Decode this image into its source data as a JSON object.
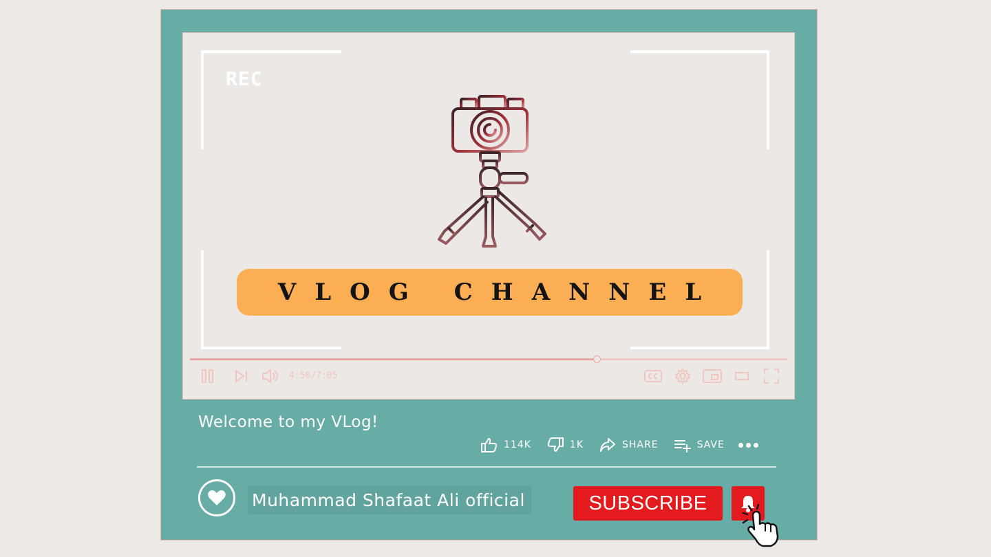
{
  "video": {
    "overlay_rec": "REC",
    "banner_text": "VLOG CHANNEL",
    "progress_fraction": 0.682,
    "time_display": "4:50/7:05",
    "title": "Welcome to my VLog!"
  },
  "icons": {
    "camera": "camera-on-tripod-icon",
    "pause": "pause-icon",
    "next": "next-icon",
    "volume": "volume-icon",
    "captions": "cc-icon",
    "settings": "gear-icon",
    "miniplayer": "miniplayer-icon",
    "theater": "theater-icon",
    "fullscreen": "fullscreen-icon",
    "like": "thumbs-up-icon",
    "dislike": "thumbs-down-icon",
    "share": "share-icon",
    "save": "playlist-add-icon",
    "more": "more-dots-icon",
    "avatar": "heart-icon",
    "bell": "bell-icon",
    "cursor": "hand-pointer-icon"
  },
  "actions": {
    "likes": "114K",
    "dislikes": "1K",
    "share_label": "SHARE",
    "save_label": "SAVE"
  },
  "channel": {
    "name": "Muhammad Shafaat Ali official",
    "subscribe_label": "SUBSCRIBE"
  },
  "colors": {
    "frame": "#67aca5",
    "screen": "#ece8e5",
    "banner": "#fcae55",
    "subscribe": "#e31b1f",
    "controls": "#f0c6c0"
  }
}
